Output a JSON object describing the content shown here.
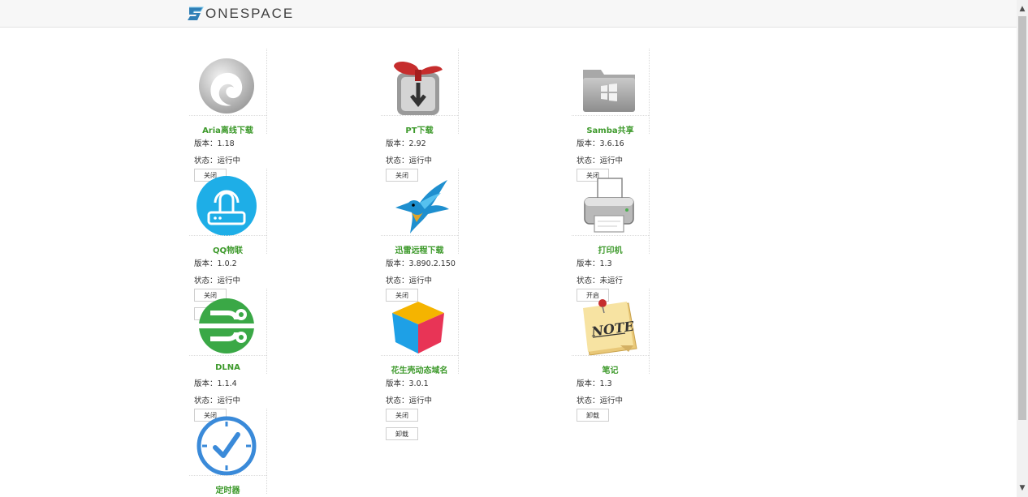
{
  "header": {
    "logo_text": "ONESPACE"
  },
  "apps": [
    {
      "name": "Aria离线下载",
      "version_label": "版本：1.18",
      "status_label": "状态：运行中",
      "buttons": [
        "关闭"
      ],
      "icon": "aria-swirl-icon"
    },
    {
      "name": "PT下载",
      "version_label": "版本：2.92",
      "status_label": "状态：运行中",
      "buttons": [
        "关闭"
      ],
      "icon": "transmission-icon"
    },
    {
      "name": "Samba共享",
      "version_label": "版本：3.6.16",
      "status_label": "状态：运行中",
      "buttons": [
        "关闭"
      ],
      "icon": "windows-folder-icon"
    },
    {
      "name": "QQ物联",
      "version_label": "版本：1.0.2",
      "status_label": "状态：运行中",
      "buttons": [
        "关闭",
        "卸载"
      ],
      "icon": "router-icon"
    },
    {
      "name": "迅雷远程下载",
      "version_label": "版本：3.890.2.150",
      "status_label": "状态：运行中",
      "buttons": [
        "关闭"
      ],
      "icon": "hummingbird-icon"
    },
    {
      "name": "打印机",
      "version_label": "版本：1.3",
      "status_label": "状态：未运行",
      "buttons": [
        "开启"
      ],
      "icon": "printer-icon"
    },
    {
      "name": "DLNA",
      "version_label": "版本：1.1.4",
      "status_label": "状态：运行中",
      "buttons": [
        "关闭"
      ],
      "icon": "dlna-icon"
    },
    {
      "name": "花生壳动态域名",
      "version_label": "版本：3.0.1",
      "status_label": "状态：运行中",
      "buttons": [
        "关闭",
        "卸载"
      ],
      "icon": "cube-icon"
    },
    {
      "name": "笔记",
      "version_label": "版本：1.3",
      "status_label": "状态：运行中",
      "buttons": [
        "卸载"
      ],
      "icon": "note-icon"
    },
    {
      "name": "定时器",
      "icon": "clock-check-icon"
    }
  ],
  "colors": {
    "accent_green": "#3e9a2c",
    "dlna_green": "#3aa846",
    "qq_blue": "#1eaee7",
    "clock_blue": "#3a8ad9"
  }
}
